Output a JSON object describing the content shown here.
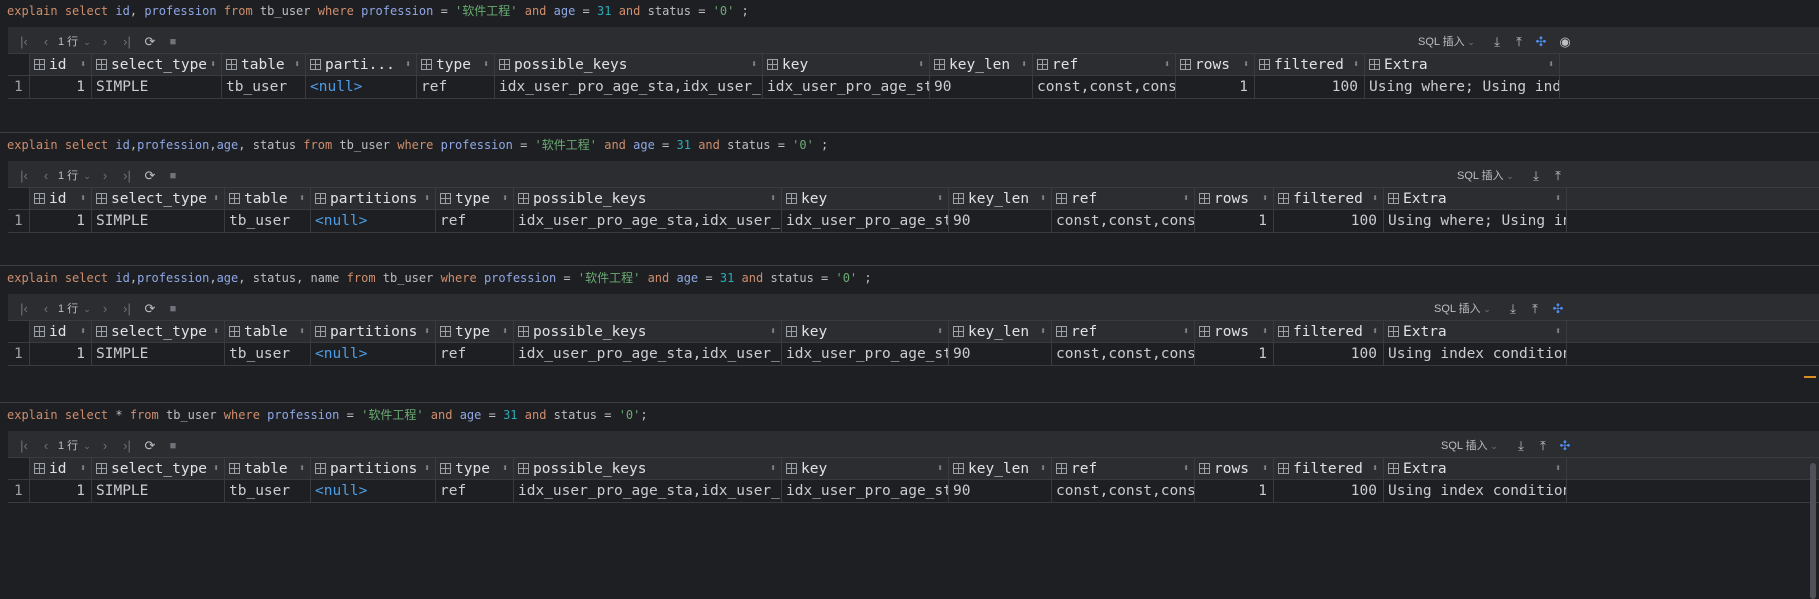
{
  "toolbar": {
    "rows_label": "1 行",
    "mode_label": "SQL 插入"
  },
  "queries": [
    {
      "sql": [
        {
          "t": "explain",
          "c": "kw"
        },
        {
          "t": " ",
          "c": "plain"
        },
        {
          "t": "select",
          "c": "kw"
        },
        {
          "t": " ",
          "c": "plain"
        },
        {
          "t": "id",
          "c": "col"
        },
        {
          "t": ", ",
          "c": "plain"
        },
        {
          "t": "profession",
          "c": "col"
        },
        {
          "t": " ",
          "c": "plain"
        },
        {
          "t": "from",
          "c": "kw"
        },
        {
          "t": " tb_user ",
          "c": "plain"
        },
        {
          "t": "where",
          "c": "kw"
        },
        {
          "t": " ",
          "c": "plain"
        },
        {
          "t": "profession",
          "c": "col"
        },
        {
          "t": " = ",
          "c": "plain"
        },
        {
          "t": "'软件工程'",
          "c": "str"
        },
        {
          "t": " ",
          "c": "plain"
        },
        {
          "t": "and",
          "c": "kw"
        },
        {
          "t": " ",
          "c": "plain"
        },
        {
          "t": "age",
          "c": "col"
        },
        {
          "t": " = ",
          "c": "plain"
        },
        {
          "t": "31",
          "c": "num"
        },
        {
          "t": " ",
          "c": "plain"
        },
        {
          "t": "and",
          "c": "kw"
        },
        {
          "t": " status = ",
          "c": "plain"
        },
        {
          "t": "'0'",
          "c": "str"
        },
        {
          "t": " ;",
          "c": "plain"
        }
      ],
      "columns": [
        "id",
        "select_type",
        "table",
        "parti...",
        "type",
        "possible_keys",
        "key",
        "key_len",
        "ref",
        "rows",
        "filtered",
        "Extra"
      ],
      "row": [
        "1",
        "SIMPLE",
        "tb_user",
        "<null>",
        "ref",
        "idx_user_pro_age_sta,idx_user_pro",
        "idx_user_pro_age_sta",
        "90",
        "const,const,const",
        "1",
        "100",
        "Using where; Using index"
      ]
    },
    {
      "sql": [
        {
          "t": "explain",
          "c": "kw"
        },
        {
          "t": " ",
          "c": "plain"
        },
        {
          "t": "select",
          "c": "kw"
        },
        {
          "t": " ",
          "c": "plain"
        },
        {
          "t": "id",
          "c": "col"
        },
        {
          "t": ",",
          "c": "plain"
        },
        {
          "t": "profession",
          "c": "col"
        },
        {
          "t": ",",
          "c": "plain"
        },
        {
          "t": "age",
          "c": "col"
        },
        {
          "t": ", status ",
          "c": "plain"
        },
        {
          "t": "from",
          "c": "kw"
        },
        {
          "t": " tb_user ",
          "c": "plain"
        },
        {
          "t": "where",
          "c": "kw"
        },
        {
          "t": " ",
          "c": "plain"
        },
        {
          "t": "profession",
          "c": "col"
        },
        {
          "t": " = ",
          "c": "plain"
        },
        {
          "t": "'软件工程'",
          "c": "str"
        },
        {
          "t": " ",
          "c": "plain"
        },
        {
          "t": "and",
          "c": "kw"
        },
        {
          "t": " ",
          "c": "plain"
        },
        {
          "t": "age",
          "c": "col"
        },
        {
          "t": " = ",
          "c": "plain"
        },
        {
          "t": "31",
          "c": "num"
        },
        {
          "t": " ",
          "c": "plain"
        },
        {
          "t": "and",
          "c": "kw"
        },
        {
          "t": " status = ",
          "c": "plain"
        },
        {
          "t": "'0'",
          "c": "str"
        },
        {
          "t": " ;",
          "c": "plain"
        }
      ],
      "columns": [
        "id",
        "select_type",
        "table",
        "partitions",
        "type",
        "possible_keys",
        "key",
        "key_len",
        "ref",
        "rows",
        "filtered",
        "Extra"
      ],
      "row": [
        "1",
        "SIMPLE",
        "tb_user",
        "<null>",
        "ref",
        "idx_user_pro_age_sta,idx_user_pro",
        "idx_user_pro_age_sta",
        "90",
        "const,const,const",
        "1",
        "100",
        "Using where; Using inde"
      ]
    },
    {
      "sql": [
        {
          "t": "explain",
          "c": "kw"
        },
        {
          "t": " ",
          "c": "plain"
        },
        {
          "t": "select",
          "c": "kw"
        },
        {
          "t": " ",
          "c": "plain"
        },
        {
          "t": "id",
          "c": "col"
        },
        {
          "t": ",",
          "c": "plain"
        },
        {
          "t": "profession",
          "c": "col"
        },
        {
          "t": ",",
          "c": "plain"
        },
        {
          "t": "age",
          "c": "col"
        },
        {
          "t": ", status, name ",
          "c": "plain"
        },
        {
          "t": "from",
          "c": "kw"
        },
        {
          "t": " tb_user ",
          "c": "plain"
        },
        {
          "t": "where",
          "c": "kw"
        },
        {
          "t": " ",
          "c": "plain"
        },
        {
          "t": "profession",
          "c": "col"
        },
        {
          "t": " = ",
          "c": "plain"
        },
        {
          "t": "'软件工程'",
          "c": "str"
        },
        {
          "t": " ",
          "c": "plain"
        },
        {
          "t": "and",
          "c": "kw"
        },
        {
          "t": " ",
          "c": "plain"
        },
        {
          "t": "age",
          "c": "col"
        },
        {
          "t": " = ",
          "c": "plain"
        },
        {
          "t": "31",
          "c": "num"
        },
        {
          "t": " ",
          "c": "plain"
        },
        {
          "t": "and",
          "c": "kw"
        },
        {
          "t": " status = ",
          "c": "plain"
        },
        {
          "t": "'0'",
          "c": "str"
        },
        {
          "t": " ;",
          "c": "plain"
        }
      ],
      "columns": [
        "id",
        "select_type",
        "table",
        "partitions",
        "type",
        "possible_keys",
        "key",
        "key_len",
        "ref",
        "rows",
        "filtered",
        "Extra"
      ],
      "row": [
        "1",
        "SIMPLE",
        "tb_user",
        "<null>",
        "ref",
        "idx_user_pro_age_sta,idx_user_pro",
        "idx_user_pro_age_sta",
        "90",
        "const,const,const",
        "1",
        "100",
        "Using index condition"
      ]
    },
    {
      "sql": [
        {
          "t": "explain",
          "c": "kw"
        },
        {
          "t": " ",
          "c": "plain"
        },
        {
          "t": "select",
          "c": "kw"
        },
        {
          "t": " * ",
          "c": "plain"
        },
        {
          "t": "from",
          "c": "kw"
        },
        {
          "t": " tb_user ",
          "c": "plain"
        },
        {
          "t": "where",
          "c": "kw"
        },
        {
          "t": " ",
          "c": "plain"
        },
        {
          "t": "profession",
          "c": "col"
        },
        {
          "t": " = ",
          "c": "plain"
        },
        {
          "t": "'软件工程'",
          "c": "str"
        },
        {
          "t": " ",
          "c": "plain"
        },
        {
          "t": "and",
          "c": "kw"
        },
        {
          "t": " ",
          "c": "plain"
        },
        {
          "t": "age",
          "c": "col"
        },
        {
          "t": " = ",
          "c": "plain"
        },
        {
          "t": "31",
          "c": "num"
        },
        {
          "t": " ",
          "c": "plain"
        },
        {
          "t": "and",
          "c": "kw"
        },
        {
          "t": " status = ",
          "c": "plain"
        },
        {
          "t": "'0'",
          "c": "str"
        },
        {
          "t": ";",
          "c": "plain"
        }
      ],
      "columns": [
        "id",
        "select_type",
        "table",
        "partitions",
        "type",
        "possible_keys",
        "key",
        "key_len",
        "ref",
        "rows",
        "filtered",
        "Extra"
      ],
      "row": [
        "1",
        "SIMPLE",
        "tb_user",
        "<null>",
        "ref",
        "idx_user_pro_age_sta,idx_user_pro",
        "idx_user_pro_age_sta",
        "90",
        "const,const,const",
        "1",
        "100",
        "Using index condition"
      ]
    }
  ]
}
